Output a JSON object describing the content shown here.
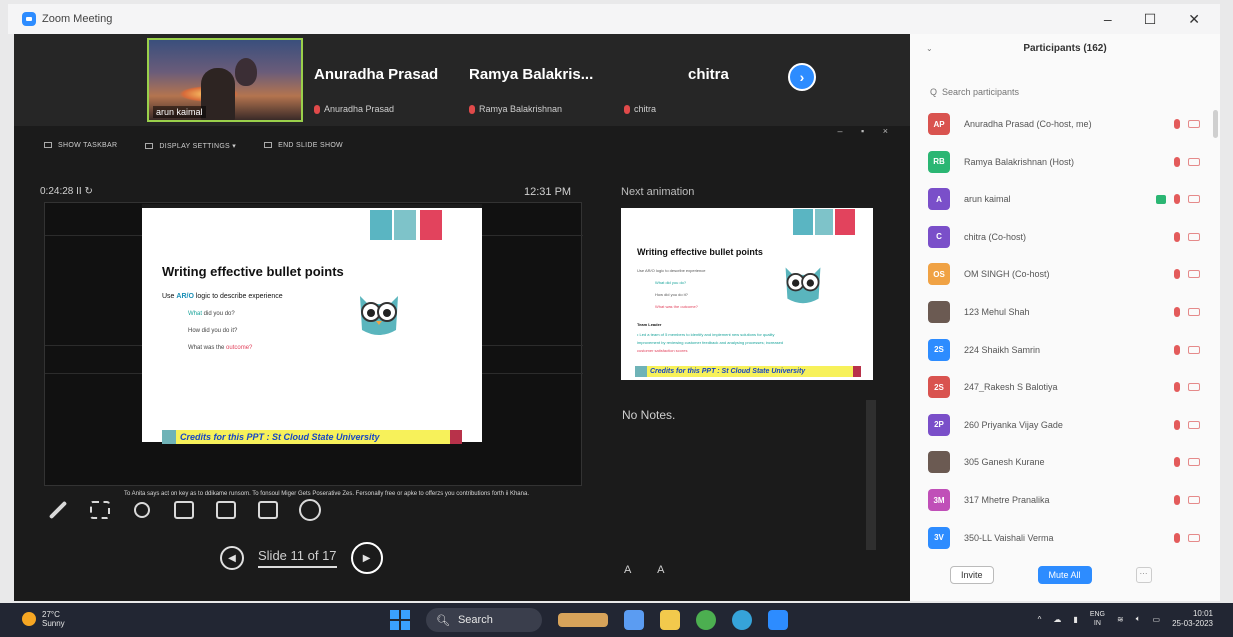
{
  "window": {
    "title": "Zoom Meeting",
    "controls": [
      "–",
      "☐",
      "✕"
    ]
  },
  "strip": {
    "self_name": "arun kaimal",
    "tiles": [
      {
        "big": "Anuradha Prasad",
        "small": "Anuradha Prasad"
      },
      {
        "big": "Ramya  Balakris...",
        "small": "Ramya Balakrishnan"
      },
      {
        "big": "chitra",
        "small": "chitra"
      }
    ],
    "next_label": "›",
    "tools": "– ▪ ×"
  },
  "presenter_toolbar": {
    "show_taskbar": "SHOW TASKBAR",
    "display_settings": "DISPLAY SETTINGS ▾",
    "end_slide_show": "END SLIDE SHOW"
  },
  "timer": {
    "elapsed": "0:24:28   II   ↻",
    "clock": "12:31 PM"
  },
  "slide": {
    "title": "Writing effective bullet points",
    "line1_prefix": "Use ",
    "line1_highlight": "AR/O",
    "line1_suffix": " logic to describe experience",
    "bullets": [
      {
        "accent": "What",
        "rest": " did you do?"
      },
      {
        "accent": "",
        "rest": "How did you do it?"
      },
      {
        "accent": "",
        "rest": "What was the ",
        "result": "outcome?"
      }
    ],
    "credits": "Credits for this PPT : St Cloud State University",
    "subtitle": "To Anita says act on key as to ddikame runsom. To fonsoul Miger Gets Poserative Zes. Fersonally free or apke to offerzs you contributions forth ii Khana."
  },
  "bottom_tools": {
    "slide_label": "Slide 11 of 17",
    "prev": "◀",
    "next": "▶"
  },
  "preview": {
    "next_label": "Next animation",
    "title": "Writing effective bullet points",
    "l1": "Use AR/O logic to describe experience",
    "l2": "What did you do?",
    "l3": "How did you do it?",
    "l4": "What was the outcome?",
    "l5": "Team Leader",
    "l6": "• Led a team of 5 members to identify and implement new solutions for quality",
    "l7": "improvement by reviewing customer feedback and analysing processes; increased",
    "l8": "customer satisfaction scores",
    "credits": "Credits for this PPT : St Cloud State University",
    "notes": "No Notes.",
    "font_controls": "A  A"
  },
  "participants": {
    "header": "Participants (162)",
    "collapse": "⌄",
    "search_placeholder": "Q  Search participants",
    "rows": [
      {
        "initials": "AP",
        "name": "Anuradha Prasad  (Co-host, me)",
        "color": "#d9534f"
      },
      {
        "initials": "RB",
        "name": "Ramya Balakrishnan  (Host)",
        "color": "#2bb673"
      },
      {
        "initials": "A",
        "name": "arun kaimal",
        "color": "#7a4fc9"
      },
      {
        "initials": "C",
        "name": "chitra  (Co-host)",
        "color": "#7a4fc9"
      },
      {
        "initials": "OS",
        "name": "OM SINGH  (Co-host)",
        "color": "#f0a244"
      },
      {
        "initials": "",
        "name": "123 Mehul Shah",
        "color": "#6b5a52"
      },
      {
        "initials": "2S",
        "name": "224 Shaikh Samrin",
        "color": "#2d8cff"
      },
      {
        "initials": "2S",
        "name": "247_Rakesh S Balotiya",
        "color": "#d9534f"
      },
      {
        "initials": "2P",
        "name": "260 Priyanka Vijay Gade",
        "color": "#7a4fc9"
      },
      {
        "initials": "",
        "name": "305 Ganesh Kurane",
        "color": "#6b5a52"
      },
      {
        "initials": "3M",
        "name": "317 Mhetre Pranalika",
        "color": "#c04fb8"
      },
      {
        "initials": "3V",
        "name": "350-LL Vaishali Verma",
        "color": "#2d8cff"
      }
    ],
    "invite": "Invite",
    "mute_all": "Mute All",
    "more": "···"
  },
  "taskbar": {
    "temp": "27°C",
    "weather": "Sunny",
    "search": "Search",
    "lang1": "ENG",
    "lang2": "IN",
    "time": "10:01",
    "date": "25-03-2023"
  }
}
